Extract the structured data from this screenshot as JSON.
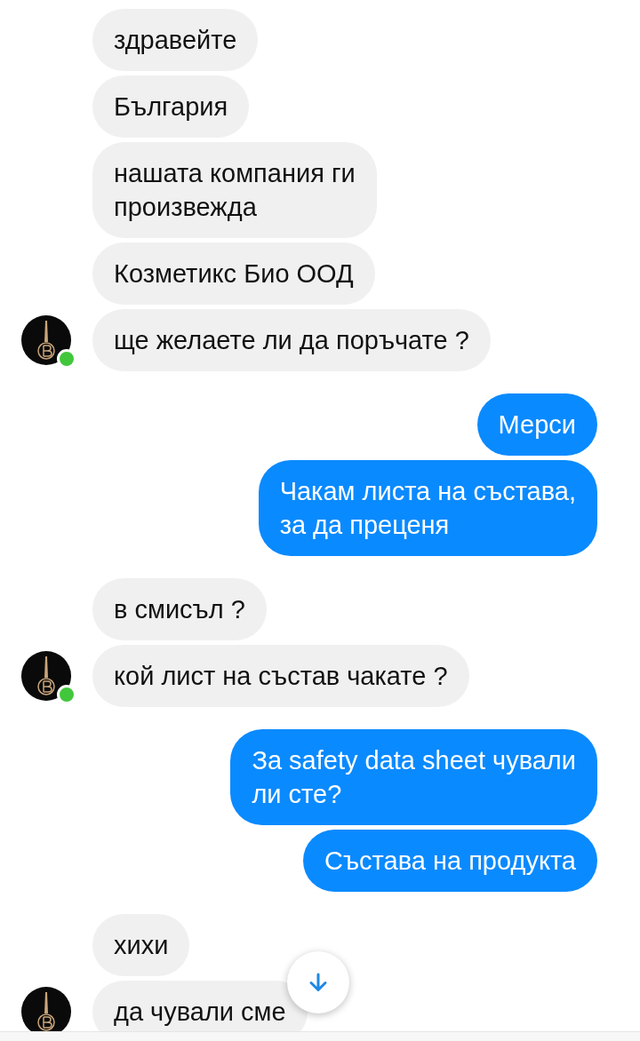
{
  "groups": [
    {
      "kind": "them",
      "online": true,
      "messages": [
        "здравейте",
        "България",
        "нашата компания ги\nпроизвежда",
        "Козметикс Био ООД",
        "ще желаете ли да поръчате ?"
      ]
    },
    {
      "kind": "me",
      "messages": [
        "Мерси",
        "Чакам листа на състава,\nза да преценя"
      ]
    },
    {
      "kind": "them",
      "online": true,
      "messages": [
        "в смисъл ?",
        "кой лист на състав чакате ?"
      ]
    },
    {
      "kind": "me",
      "messages": [
        "За safety data sheet чували\nли сте?",
        "Състава на продукта"
      ]
    },
    {
      "kind": "them",
      "messages": [
        "хихи",
        "да чували сме"
      ]
    }
  ]
}
